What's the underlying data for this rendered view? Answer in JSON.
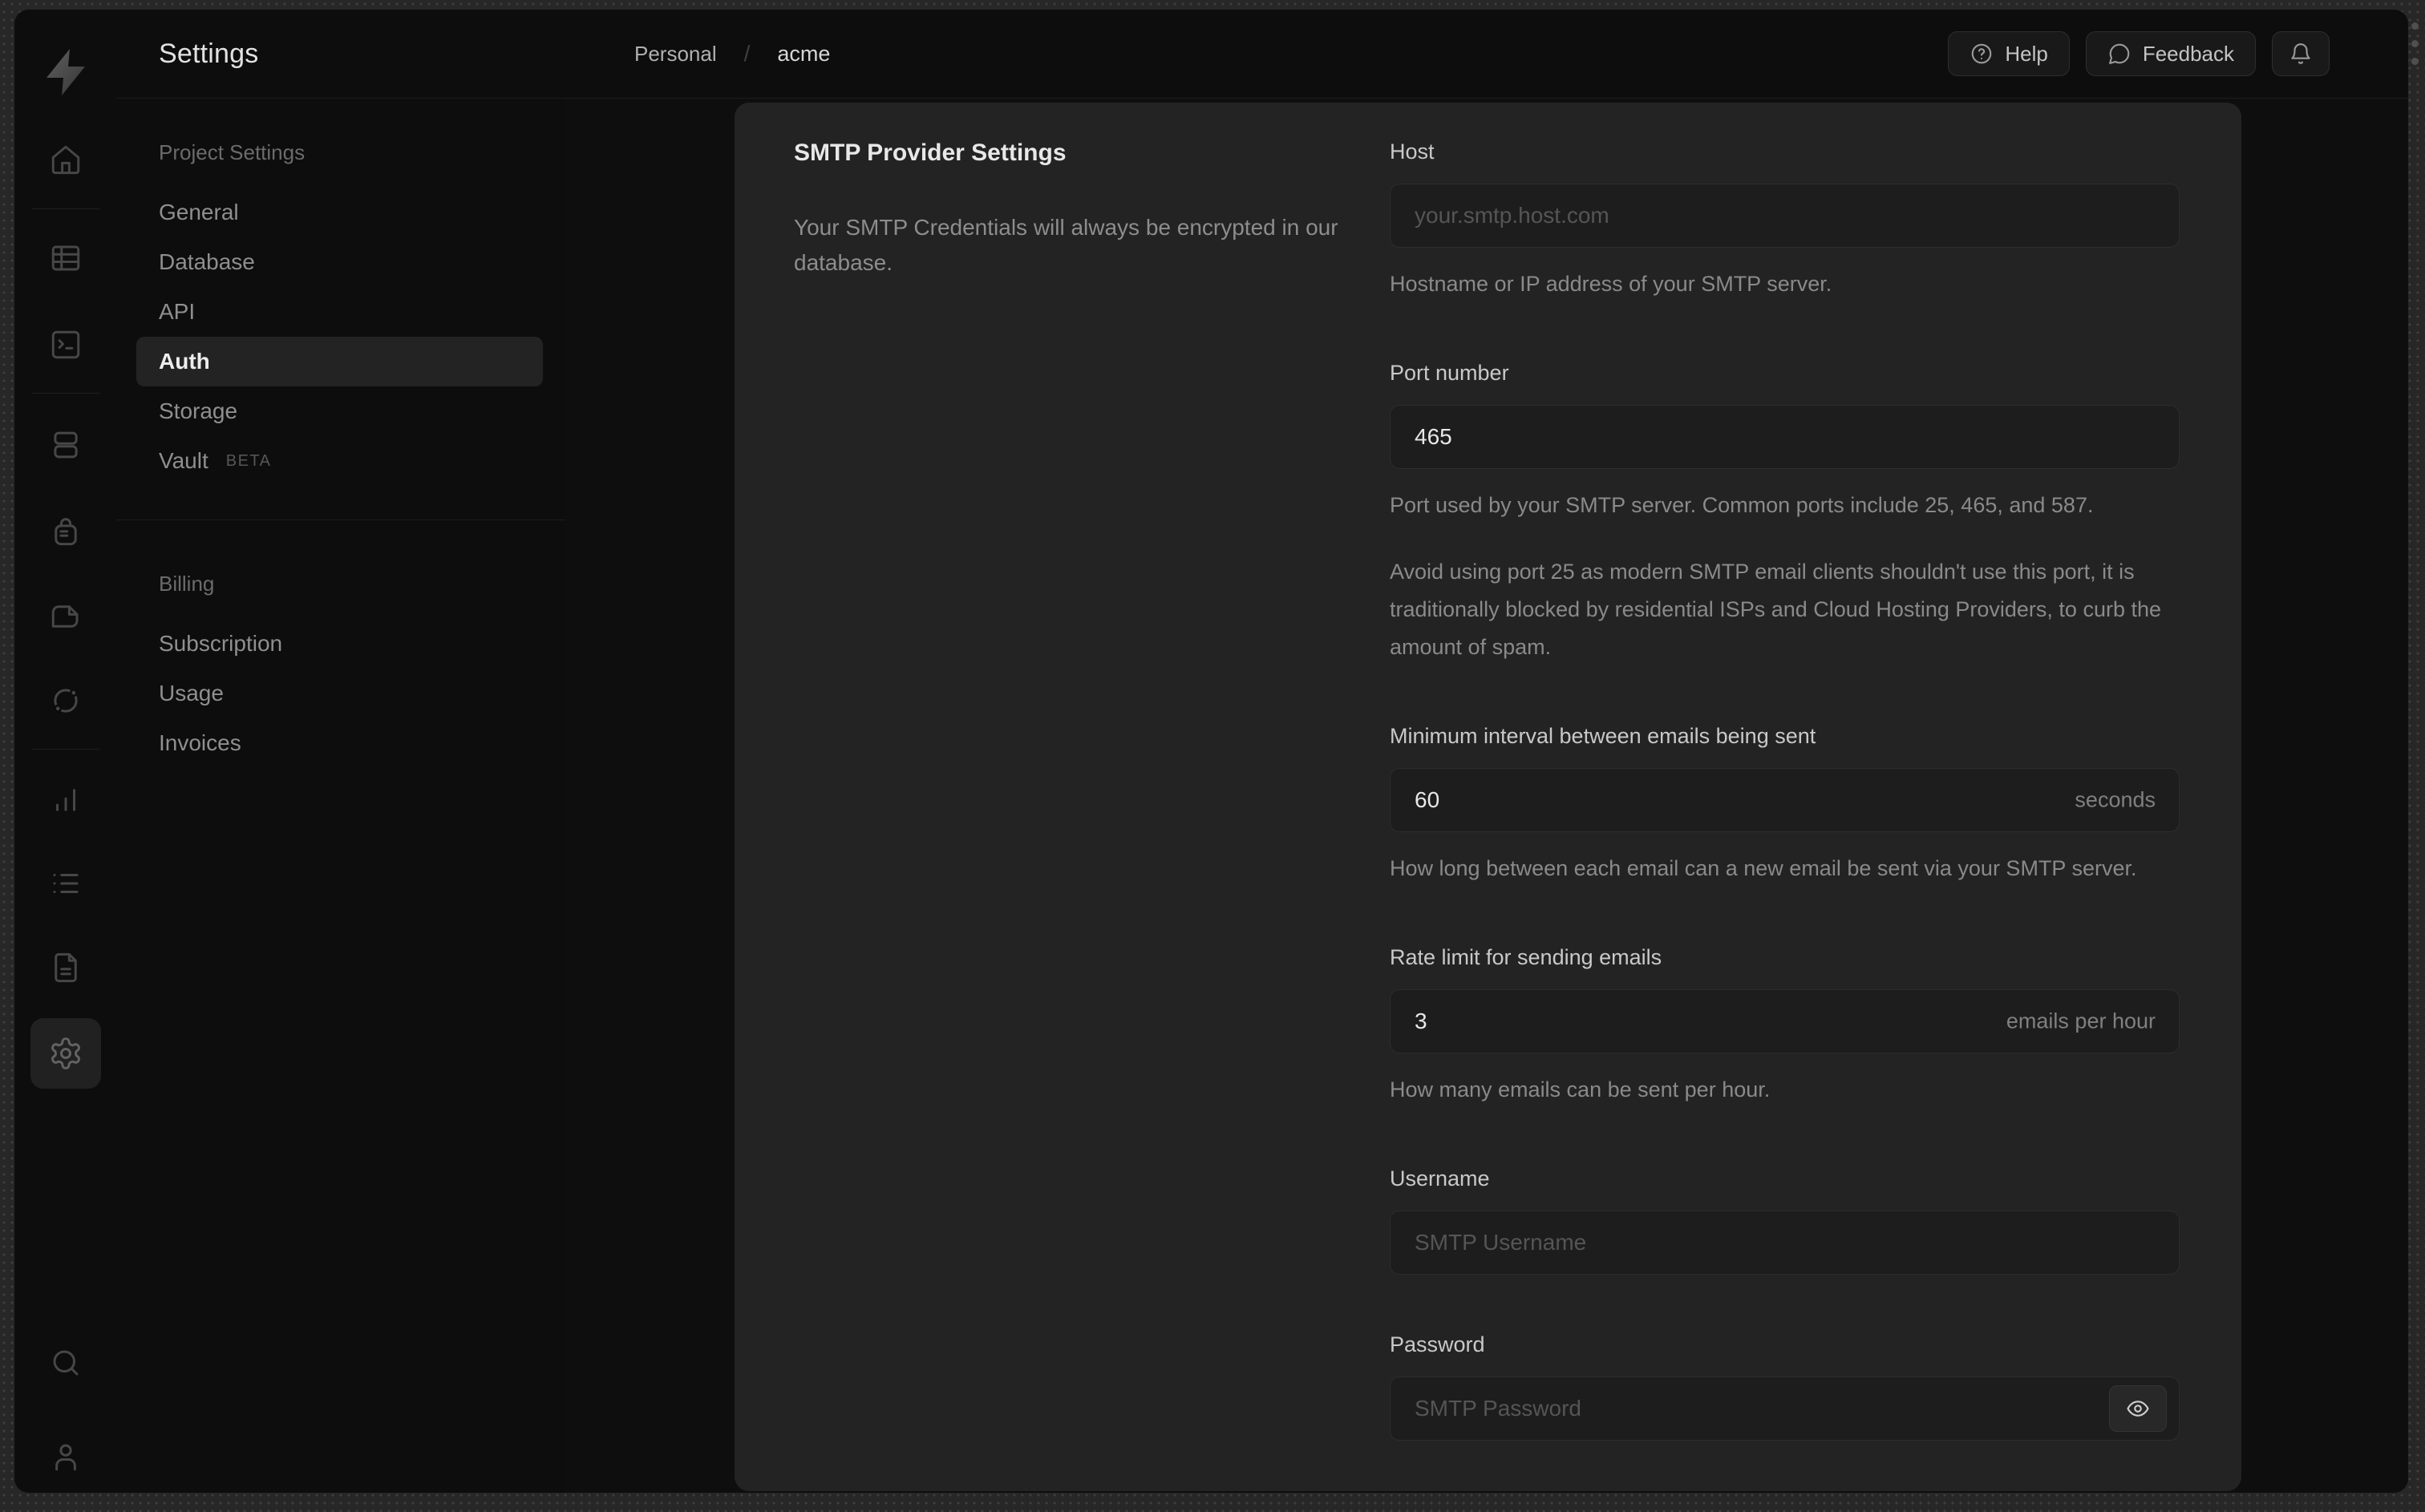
{
  "rail": {
    "icons": [
      "supabase-logo",
      "home-icon",
      "table-editor-icon",
      "sql-editor-icon",
      "database-icon",
      "auth-lock-icon",
      "storage-icon",
      "edge-functions-icon",
      "reports-icon",
      "logs-icon",
      "api-docs-icon",
      "settings-gear-icon",
      "search-icon",
      "user-icon"
    ]
  },
  "sidebar": {
    "title": "Settings",
    "project_section": {
      "header": "Project Settings",
      "items": [
        {
          "label": "General"
        },
        {
          "label": "Database"
        },
        {
          "label": "API"
        },
        {
          "label": "Auth"
        },
        {
          "label": "Storage"
        },
        {
          "label": "Vault",
          "badge": "BETA"
        }
      ]
    },
    "billing_section": {
      "header": "Billing",
      "items": [
        {
          "label": "Subscription"
        },
        {
          "label": "Usage"
        },
        {
          "label": "Invoices"
        }
      ]
    }
  },
  "header": {
    "breadcrumb": {
      "org": "Personal",
      "separator": "/",
      "project": "acme"
    },
    "help_label": "Help",
    "feedback_label": "Feedback"
  },
  "panel": {
    "section_title": "SMTP Provider Settings",
    "section_description": "Your SMTP Credentials will always be encrypted in our database.",
    "fields": {
      "host": {
        "label": "Host",
        "placeholder": "your.smtp.host.com",
        "help": "Hostname or IP address of your SMTP server."
      },
      "port": {
        "label": "Port number",
        "value": "465",
        "help": "Port used by your SMTP server. Common ports include 25, 465, and 587.",
        "note": "Avoid using port 25 as modern SMTP email clients shouldn't use this port, it is traditionally blocked by residential ISPs and Cloud Hosting Providers, to curb the amount of spam."
      },
      "min_interval": {
        "label": "Minimum interval between emails being sent",
        "value": "60",
        "suffix": "seconds",
        "help": "How long between each email can a new email be sent via your SMTP server."
      },
      "rate_limit": {
        "label": "Rate limit for sending emails",
        "value": "3",
        "suffix": "emails per hour",
        "help": "How many emails can be sent per hour."
      },
      "username": {
        "label": "Username",
        "placeholder": "SMTP Username"
      },
      "password": {
        "label": "Password",
        "placeholder": "SMTP Password"
      }
    }
  }
}
